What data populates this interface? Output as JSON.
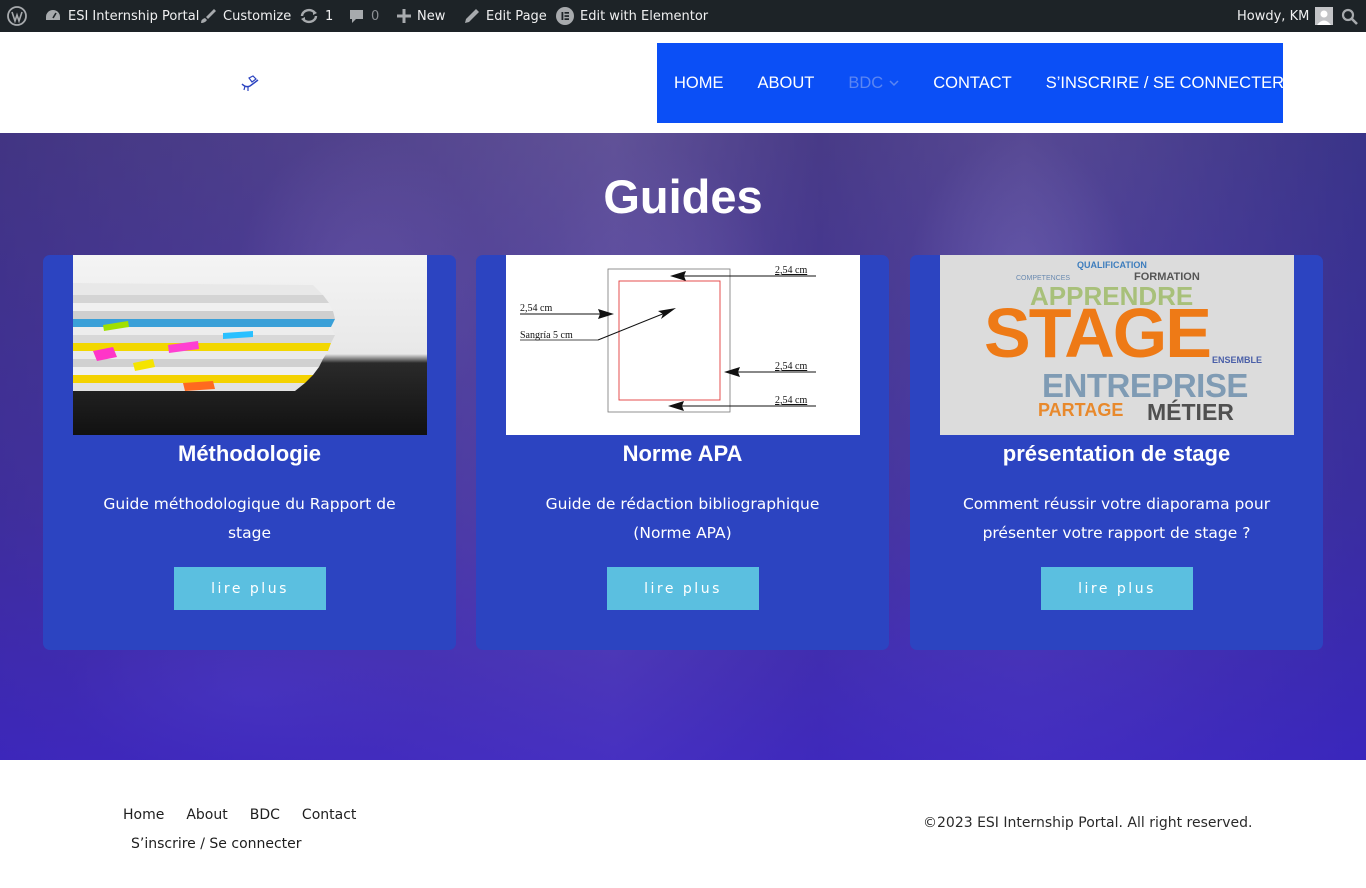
{
  "admin_bar": {
    "site_name": "ESI Internship Portal",
    "customize": "Customize",
    "updates_count": "1",
    "comments_count": "0",
    "new": "New",
    "edit_page": "Edit Page",
    "edit_elementor": "Edit with Elementor",
    "howdy": "Howdy, KM"
  },
  "nav": {
    "items": [
      {
        "label": "HOME"
      },
      {
        "label": "ABOUT"
      },
      {
        "label": "BDC"
      },
      {
        "label": "CONTACT"
      },
      {
        "label": "S’INSCRIRE / SE CONNECTER"
      }
    ],
    "accent": "#0b4ff6"
  },
  "hero": {
    "title": "Guides",
    "cards": [
      {
        "title": "Méthodologie",
        "description": "Guide méthodologique du Rapport de stage",
        "button": "lire plus"
      },
      {
        "title": "Norme APA",
        "description": "Guide de rédaction bibliographique (Norme APA)",
        "button": "lire plus",
        "image_labels": {
          "top": "2,54 cm",
          "left": "2,54 cm",
          "sangria": "Sangría 5 cm",
          "right": "2,54 cm",
          "bottom": "2,54 cm"
        }
      },
      {
        "title": "présentation de stage",
        "description": "Comment réussir votre diaporama pour présenter votre rapport de stage ?",
        "button": "lire plus",
        "image_words": {
          "main": "STAGE",
          "apprendre": "APPRENDRE",
          "entreprise": "ENTREPRISE",
          "partage": "PARTAGE",
          "metier": "MÉTIER",
          "qualification": "QUALIFICATION",
          "formation": "FORMATION",
          "ensemble": "ENSEMBLE",
          "competences": "COMPETENCES"
        }
      }
    ]
  },
  "footer": {
    "links": [
      "Home",
      "About",
      "BDC",
      "Contact"
    ],
    "link_second_row": "S’inscrire / Se connecter",
    "copyright": "©2023 ESI Internship Portal. All right reserved."
  }
}
